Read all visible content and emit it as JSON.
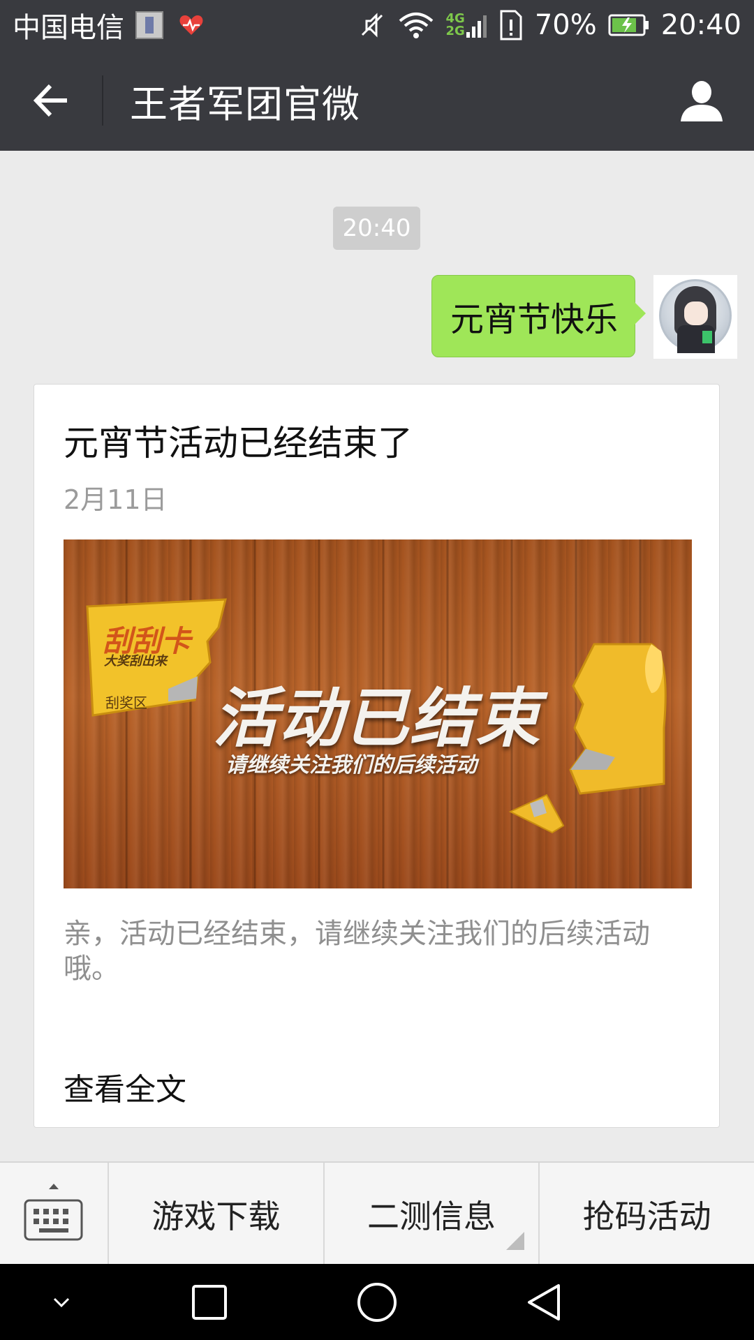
{
  "status_bar": {
    "carrier": "中国电信",
    "net_top": "4G",
    "net_bottom": "2G",
    "battery": "70%",
    "time": "20:40"
  },
  "header": {
    "title": "王者军团官微"
  },
  "chat": {
    "timestamp": "20:40",
    "sent_message": "元宵节快乐"
  },
  "article": {
    "title": "元宵节活动已经结束了",
    "date": "2月11日",
    "image": {
      "headline": "活动已结束",
      "subline": "请继续关注我们的后续活动",
      "card_title": "刮刮卡",
      "card_sub": "大奖刮出来",
      "card_area": "刮奖区"
    },
    "description": "亲，活动已经结束，请继续关注我们的后续活动哦。",
    "read_more": "查看全文"
  },
  "menu": {
    "items": [
      "游戏下载",
      "二测信息",
      "抢码活动"
    ]
  },
  "colors": {
    "bar_bg": "#393a3f",
    "bubble_green": "#9fe658",
    "chat_bg": "#ebebeb"
  }
}
